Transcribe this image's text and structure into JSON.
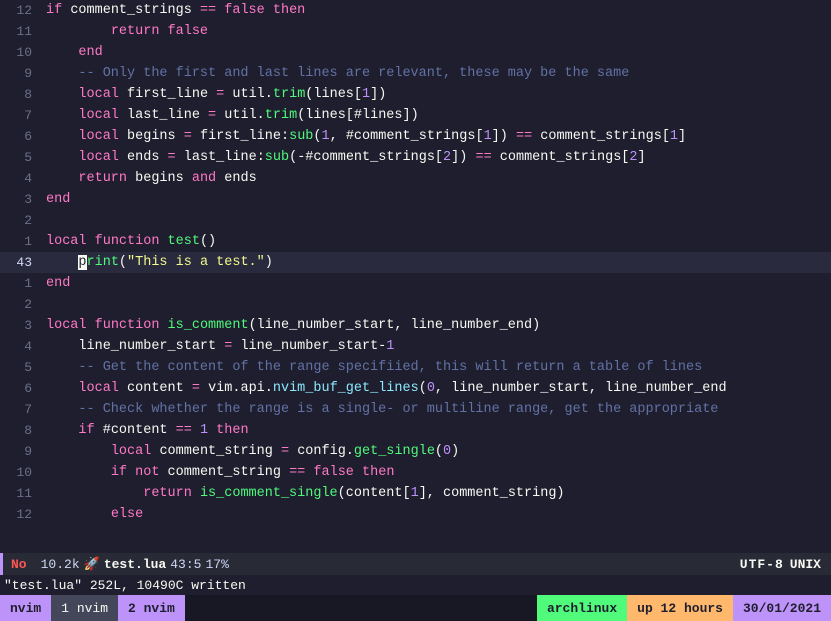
{
  "editor": {
    "lines": [
      {
        "num": "12",
        "content": [
          {
            "t": "    ",
            "c": ""
          },
          {
            "t": "if",
            "c": "kw"
          },
          {
            "t": " comment_strings ",
            "c": "var"
          },
          {
            "t": "==",
            "c": "op"
          },
          {
            "t": " ",
            "c": ""
          },
          {
            "t": "false",
            "c": "bool"
          },
          {
            "t": " ",
            "c": ""
          },
          {
            "t": "then",
            "c": "kw"
          }
        ]
      },
      {
        "num": "11",
        "content": [
          {
            "t": "        ",
            "c": ""
          },
          {
            "t": "return",
            "c": "kw"
          },
          {
            "t": " ",
            "c": ""
          },
          {
            "t": "false",
            "c": "bool"
          }
        ]
      },
      {
        "num": "10",
        "content": [
          {
            "t": "    ",
            "c": ""
          },
          {
            "t": "end",
            "c": "kw"
          }
        ]
      },
      {
        "num": "9",
        "content": [
          {
            "t": "    ",
            "c": ""
          },
          {
            "t": "-- Only the first and last lines are relevant, these may be the same",
            "c": "comment"
          }
        ]
      },
      {
        "num": "8",
        "content": [
          {
            "t": "    ",
            "c": ""
          },
          {
            "t": "local",
            "c": "kw"
          },
          {
            "t": " first_line ",
            "c": "var"
          },
          {
            "t": "=",
            "c": "op"
          },
          {
            "t": " util",
            "c": "var"
          },
          {
            "t": ".",
            "c": "punc"
          },
          {
            "t": "trim",
            "c": "method"
          },
          {
            "t": "(lines[",
            "c": "punc"
          },
          {
            "t": "1",
            "c": "num"
          },
          {
            "t": "])",
            "c": "punc"
          }
        ]
      },
      {
        "num": "7",
        "content": [
          {
            "t": "    ",
            "c": ""
          },
          {
            "t": "local",
            "c": "kw"
          },
          {
            "t": " last_line ",
            "c": "var"
          },
          {
            "t": "=",
            "c": "op"
          },
          {
            "t": " util",
            "c": "var"
          },
          {
            "t": ".",
            "c": "punc"
          },
          {
            "t": "trim",
            "c": "method"
          },
          {
            "t": "(lines[#lines])",
            "c": "punc"
          }
        ]
      },
      {
        "num": "6",
        "content": [
          {
            "t": "    ",
            "c": ""
          },
          {
            "t": "local",
            "c": "kw"
          },
          {
            "t": " begins ",
            "c": "var"
          },
          {
            "t": "=",
            "c": "op"
          },
          {
            "t": " first_line",
            "c": "var"
          },
          {
            "t": ":",
            "c": "punc"
          },
          {
            "t": "sub",
            "c": "method"
          },
          {
            "t": "(",
            "c": "punc"
          },
          {
            "t": "1",
            "c": "num"
          },
          {
            "t": ", #comment_strings[",
            "c": "punc"
          },
          {
            "t": "1",
            "c": "num"
          },
          {
            "t": "]) ",
            "c": "punc"
          },
          {
            "t": "==",
            "c": "op"
          },
          {
            "t": " comment_strings[",
            "c": "var"
          },
          {
            "t": "1",
            "c": "num"
          },
          {
            "t": "]",
            "c": "punc"
          }
        ]
      },
      {
        "num": "5",
        "content": [
          {
            "t": "    ",
            "c": ""
          },
          {
            "t": "local",
            "c": "kw"
          },
          {
            "t": " ends ",
            "c": "var"
          },
          {
            "t": "=",
            "c": "op"
          },
          {
            "t": " last_line",
            "c": "var"
          },
          {
            "t": ":",
            "c": "punc"
          },
          {
            "t": "sub",
            "c": "method"
          },
          {
            "t": "(-#comment_strings[",
            "c": "punc"
          },
          {
            "t": "2",
            "c": "num"
          },
          {
            "t": "]) ",
            "c": "punc"
          },
          {
            "t": "==",
            "c": "op"
          },
          {
            "t": " comment_strings[",
            "c": "var"
          },
          {
            "t": "2",
            "c": "num"
          },
          {
            "t": "]",
            "c": "punc"
          }
        ]
      },
      {
        "num": "4",
        "content": [
          {
            "t": "    ",
            "c": ""
          },
          {
            "t": "return",
            "c": "kw"
          },
          {
            "t": " begins ",
            "c": "var"
          },
          {
            "t": "and",
            "c": "kw"
          },
          {
            "t": " ends",
            "c": "var"
          }
        ]
      },
      {
        "num": "3",
        "content": [
          {
            "t": "end",
            "c": "kw"
          }
        ]
      },
      {
        "num": "2",
        "content": []
      },
      {
        "num": "1",
        "content": [
          {
            "t": "local",
            "c": "kw"
          },
          {
            "t": " ",
            "c": ""
          },
          {
            "t": "function",
            "c": "kw"
          },
          {
            "t": " ",
            "c": ""
          },
          {
            "t": "test",
            "c": "fn"
          },
          {
            "t": "()",
            "c": "punc"
          }
        ]
      },
      {
        "num": "43",
        "content": [
          {
            "t": "    ",
            "c": ""
          },
          {
            "t": "p",
            "c": "cursor-char"
          },
          {
            "t": "rint",
            "c": "fn"
          },
          {
            "t": "(\"This is a test.\")",
            "c": "str"
          }
        ],
        "current": true
      },
      {
        "num": "1",
        "content": [
          {
            "t": "end",
            "c": "kw"
          }
        ]
      },
      {
        "num": "2",
        "content": []
      },
      {
        "num": "3",
        "content": [
          {
            "t": "local",
            "c": "kw"
          },
          {
            "t": " ",
            "c": ""
          },
          {
            "t": "function",
            "c": "kw"
          },
          {
            "t": " ",
            "c": ""
          },
          {
            "t": "is_comment",
            "c": "fn"
          },
          {
            "t": "(line_number_start, line_number_end)",
            "c": "punc"
          }
        ]
      },
      {
        "num": "4",
        "content": [
          {
            "t": "    ",
            "c": ""
          },
          {
            "t": "line_number_start ",
            "c": "var"
          },
          {
            "t": "=",
            "c": "op"
          },
          {
            "t": " line_number_start-",
            "c": "var"
          },
          {
            "t": "1",
            "c": "num"
          }
        ]
      },
      {
        "num": "5",
        "content": [
          {
            "t": "    ",
            "c": ""
          },
          {
            "t": "-- Get the content of the range specifiied, this will return a table of lines",
            "c": "comment"
          }
        ]
      },
      {
        "num": "6",
        "content": [
          {
            "t": "    ",
            "c": ""
          },
          {
            "t": "local",
            "c": "kw"
          },
          {
            "t": " content ",
            "c": "var"
          },
          {
            "t": "=",
            "c": "op"
          },
          {
            "t": " vim.api.",
            "c": "var"
          },
          {
            "t": "nvim_buf_get_lines",
            "c": "special"
          },
          {
            "t": "(",
            "c": "punc"
          },
          {
            "t": "0",
            "c": "num"
          },
          {
            "t": ", line_number_start, line_number_end",
            "c": "var"
          }
        ]
      },
      {
        "num": "7",
        "content": [
          {
            "t": "    ",
            "c": ""
          },
          {
            "t": "-- Check whether the range is a single- or multiline range, get the appropriate",
            "c": "comment"
          }
        ]
      },
      {
        "num": "8",
        "content": [
          {
            "t": "    ",
            "c": ""
          },
          {
            "t": "if",
            "c": "kw"
          },
          {
            "t": " #content ",
            "c": "var"
          },
          {
            "t": "==",
            "c": "op"
          },
          {
            "t": " ",
            "c": ""
          },
          {
            "t": "1",
            "c": "num"
          },
          {
            "t": " ",
            "c": ""
          },
          {
            "t": "then",
            "c": "kw"
          }
        ]
      },
      {
        "num": "9",
        "content": [
          {
            "t": "        ",
            "c": ""
          },
          {
            "t": "local",
            "c": "kw"
          },
          {
            "t": " comment_string ",
            "c": "var"
          },
          {
            "t": "=",
            "c": "op"
          },
          {
            "t": " config.",
            "c": "var"
          },
          {
            "t": "get_single",
            "c": "method"
          },
          {
            "t": "(",
            "c": "punc"
          },
          {
            "t": "0",
            "c": "num"
          },
          {
            "t": ")",
            "c": "punc"
          }
        ]
      },
      {
        "num": "10",
        "content": [
          {
            "t": "        ",
            "c": ""
          },
          {
            "t": "if",
            "c": "kw"
          },
          {
            "t": " ",
            "c": ""
          },
          {
            "t": "not",
            "c": "kw"
          },
          {
            "t": " comment_string ",
            "c": "var"
          },
          {
            "t": "==",
            "c": "op"
          },
          {
            "t": " ",
            "c": ""
          },
          {
            "t": "false",
            "c": "bool"
          },
          {
            "t": " ",
            "c": ""
          },
          {
            "t": "then",
            "c": "kw"
          }
        ]
      },
      {
        "num": "11",
        "content": [
          {
            "t": "            ",
            "c": ""
          },
          {
            "t": "return",
            "c": "kw"
          },
          {
            "t": " ",
            "c": ""
          },
          {
            "t": "is_comment_single",
            "c": "fn"
          },
          {
            "t": "(content[",
            "c": "punc"
          },
          {
            "t": "1",
            "c": "num"
          },
          {
            "t": "], comment_string)",
            "c": "punc"
          }
        ]
      },
      {
        "num": "12",
        "content": [
          {
            "t": "        ",
            "c": ""
          },
          {
            "t": "else",
            "c": "kw"
          }
        ]
      }
    ],
    "status": {
      "mode": "No",
      "size": "10.2k",
      "filename": "test.lua",
      "line": "43",
      "col": "5",
      "percent": "17%",
      "encoding": "UTF-8",
      "os": "UNIX"
    },
    "message": "\"test.lua\" 252L, 10490C written",
    "tabs": {
      "tab1_label": "1 nvim",
      "tab2_label": "2 nvim",
      "nvim_label": "nvim"
    },
    "statusbar": {
      "arch": "archlinux",
      "uptime": "up 12 hours",
      "date": "30/01/2021"
    }
  }
}
